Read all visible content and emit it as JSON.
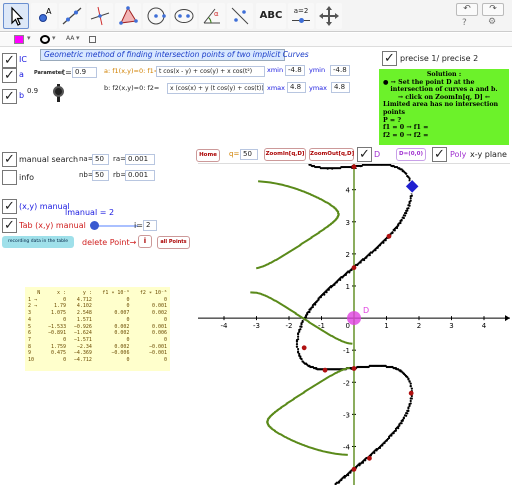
{
  "toolbar": {
    "tools": [
      "move-tool",
      "point-tool",
      "line-tool",
      "perpendicular-tool",
      "polygon-tool",
      "circle-tool",
      "ellipse-tool",
      "angle-tool",
      "reflect-tool",
      "text-tool",
      "slider-tool",
      "move-view-tool"
    ],
    "text_tool_label": "ABC",
    "slider_tool_label": "a=2",
    "undo": "↶",
    "redo": "↷",
    "help": "?",
    "settings": "⚙"
  },
  "stylebar": {
    "font_label": "AA"
  },
  "title": "Geometric method of finding intersection points of two implicit Curves",
  "checks": {
    "ic": "IC",
    "a": "a",
    "b": "b"
  },
  "parameter": {
    "label": "Parameter",
    "t_label": "t=",
    "t_value": "0.9",
    "b_value": "0.9"
  },
  "curves": {
    "a_prefix": "a: f1(x,y)=0:  f1=",
    "a_expr": "t cos(x - y) + cos(y) + x cos(t²)",
    "b_prefix": "b: f2(x,y)=0:  f2=",
    "b_expr": "x (cos(x) + y (t cos(y) + cos(t)))"
  },
  "view": {
    "xmin_label": "xmin",
    "xmin": "-4.8",
    "ymin_label": "ymin",
    "ymin": "-4.8",
    "xmax_label": "xmax",
    "xmax": "4.8",
    "ymax_label": "ymax",
    "ymax": "4.8"
  },
  "precise": {
    "label": "precise 1/ precise 2"
  },
  "solution": {
    "title": "Solution :",
    "line1": "● → Set the point D at the",
    "line2": "intersection  of curves a and b.",
    "line3": "→   click on ZoomIn[q, D]   ←",
    "line4": "Limited area has no intersection points",
    "line5": "P = ?",
    "line6": "f1 = 0 → f1 =",
    "line7": "f2 = 0 → f2 ="
  },
  "search": {
    "manual_label": "manual search",
    "info_label": "info",
    "na_label": "na=",
    "na": "50",
    "ra_label": "ra=",
    "ra": "0.001",
    "nb_label": "nb=",
    "nb": "50",
    "rb_label": "rb=",
    "rb": "0.001"
  },
  "graph_controls": {
    "home": "Home",
    "q_label": "q=",
    "q": "50",
    "zoom_in": "ZoomIn[q,D]",
    "zoom_out": "ZoomOut[q,D]",
    "d_label": "D",
    "zero_btn": "D=(0,0)",
    "poly_label": "Poly",
    "plane_label": "x-y plane"
  },
  "manual": {
    "xy_label": "(x,y) manual",
    "slider_label": "lmanual = 2",
    "tab_label": "Tab (x,y) manual",
    "i_label": "i=",
    "i_value": "2",
    "recording_btn": "recording data in the table",
    "delete_label": "delete Point→",
    "i_btn": "i",
    "all_points": "all Points"
  },
  "table": {
    "headers": [
      "N",
      "x :",
      "y :",
      "f1 ∗ 10⁻⁶",
      "f2 ∗ 10⁻⁶"
    ],
    "rows": [
      [
        "1 →",
        "0",
        "4.712",
        "0",
        "0"
      ],
      [
        "2 →",
        "1.79",
        "4.102",
        "0",
        "0.001"
      ],
      [
        "3",
        "1.075",
        "2.548",
        "0.007",
        "0.002"
      ],
      [
        "4",
        "0",
        "1.571",
        "0",
        "0"
      ],
      [
        "5",
        "−1.533",
        "−0.926",
        "0.002",
        "0.001"
      ],
      [
        "6",
        "−0.891",
        "−1.624",
        "0.002",
        "0.006"
      ],
      [
        "7",
        "0",
        "−1.571",
        "0",
        "0"
      ],
      [
        "8",
        "1.759",
        "−2.34",
        "0.002",
        "−0.001"
      ],
      [
        "9",
        "0.475",
        "−4.369",
        "−0.006",
        "−0.001"
      ],
      [
        "10",
        "0",
        "−4.712",
        "0",
        "0"
      ]
    ]
  },
  "axes": {
    "x_ticks": [
      "-4",
      "-3",
      "-2",
      "-1",
      "1",
      "2",
      "3",
      "4"
    ],
    "y_ticks": [
      "4",
      "3",
      "2",
      "1",
      "-1",
      "-2",
      "-3",
      "-4"
    ],
    "origin": "0",
    "point_d": "D"
  },
  "chart_data": {
    "type": "scatter",
    "xlim": [
      -4.8,
      4.8
    ],
    "ylim": [
      -5.2,
      4.8
    ],
    "grid": false,
    "series": [
      {
        "values": [
          [
            0,
            4.712
          ],
          [
            1.79,
            4.102
          ],
          [
            1.075,
            2.548
          ],
          [
            0,
            1.571
          ],
          [
            -1.533,
            -0.926
          ],
          [
            -0.891,
            -1.624
          ],
          [
            0,
            -1.571
          ],
          [
            1.759,
            -2.34
          ],
          [
            0.475,
            -4.369
          ],
          [
            0,
            -4.712
          ]
        ]
      }
    ]
  },
  "colors": {
    "accent": "#1a1ae0",
    "curve_b": "#5a8a1a",
    "dots": "#000000",
    "solution_bg": "#6cf22a",
    "point_d": "#e040e0",
    "point_p": "#2020d0",
    "intersection": "#b01010"
  }
}
